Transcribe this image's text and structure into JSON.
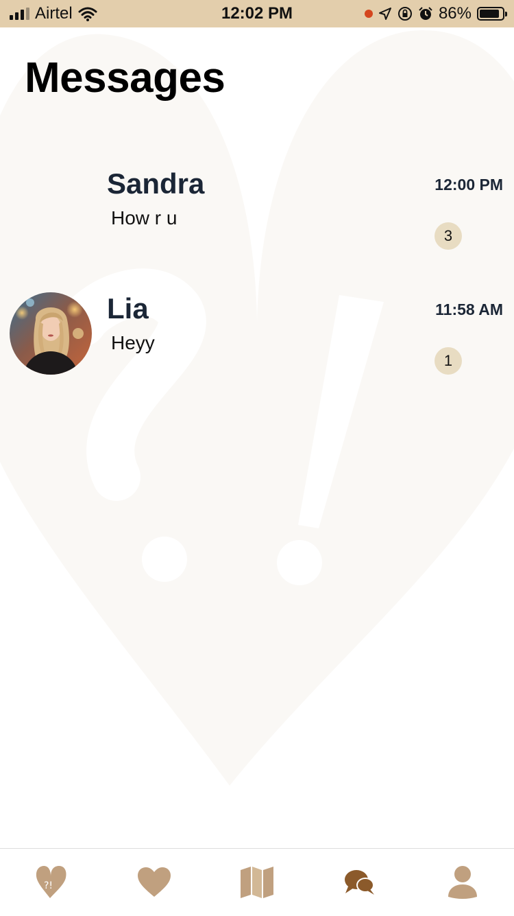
{
  "status_bar": {
    "carrier": "Airtel",
    "time": "12:02 PM",
    "battery": "86%",
    "battery_level": 0.86,
    "icons": [
      "signal-icon",
      "wifi-icon",
      "recording-dot",
      "location-arrow-icon",
      "rotation-lock-icon",
      "alarm-icon",
      "battery-icon"
    ]
  },
  "page": {
    "title": "Messages"
  },
  "conversations": [
    {
      "name": "Sandra",
      "preview": "How r u",
      "time": "12:00 PM",
      "unread": "3",
      "has_avatar": false
    },
    {
      "name": "Lia",
      "preview": "Heyy",
      "time": "11:58 AM",
      "unread": "1",
      "has_avatar": true
    }
  ],
  "tab_bar": {
    "tabs": [
      {
        "icon": "heart-question-icon",
        "active": false
      },
      {
        "icon": "heart-icon",
        "active": false
      },
      {
        "icon": "map-icon",
        "active": false
      },
      {
        "icon": "chat-bubbles-icon",
        "active": true
      },
      {
        "icon": "profile-icon",
        "active": false
      }
    ]
  },
  "colors": {
    "status_bar_bg": "#e3ceac",
    "tab_icon": "#c0a07f",
    "tab_icon_active": "#8b5a2b",
    "badge_bg": "#e8dcc2",
    "name_text": "#1b2636"
  }
}
